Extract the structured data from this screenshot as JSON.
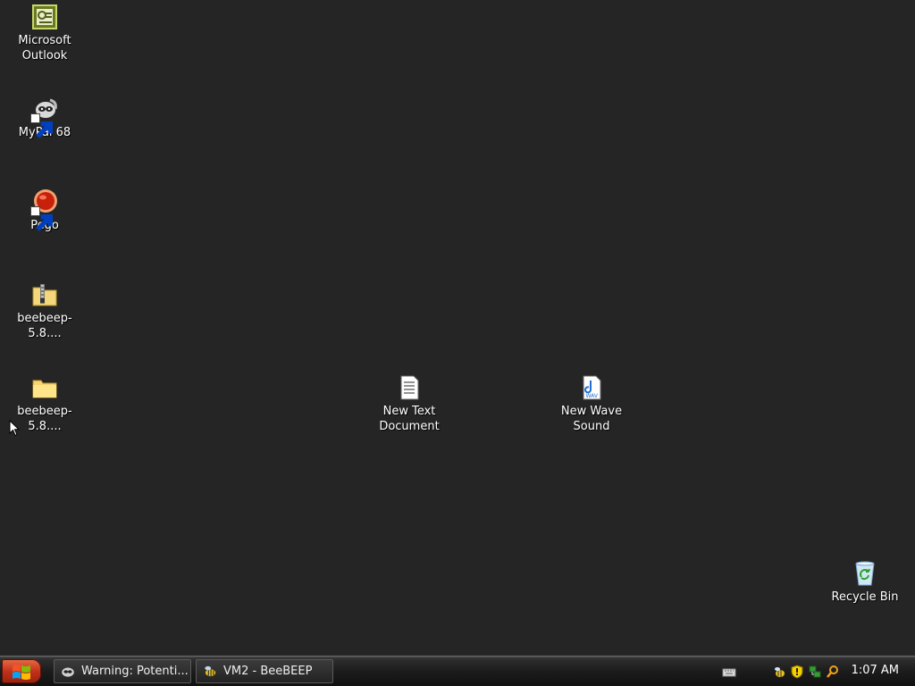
{
  "desktop": {
    "background_color": "#252525",
    "icons": {
      "outlook": {
        "label": "Microsoft\nOutlook",
        "icon": "outlook-icon"
      },
      "mypal": {
        "label": "MyPal 68",
        "icon": "mypal-raccoon-icon"
      },
      "pego": {
        "label": "Pego",
        "icon": "pego-red-ball-icon"
      },
      "beebeep_zip": {
        "label": "beebeep-5.8....",
        "icon": "zip-folder-icon"
      },
      "beebeep_folder": {
        "label": "beebeep-5.8....",
        "icon": "folder-icon"
      },
      "new_text": {
        "label": "New Text\nDocument",
        "icon": "text-document-icon"
      },
      "new_wave": {
        "label": "New Wave\nSound",
        "icon": "wav-file-icon"
      },
      "recycle_bin": {
        "label": "Recycle Bin",
        "icon": "recycle-bin-icon"
      }
    }
  },
  "taskbar": {
    "start_icon": "windows-logo-icon",
    "tasks": [
      {
        "label": "Warning: Potenti...",
        "icon": "mypal-raccoon-icon"
      },
      {
        "label": "VM2 - BeeBEEP",
        "icon": "bee-icon"
      }
    ],
    "tray_icons": [
      "keyboard-icon",
      "bee-icon",
      "security-shield-icon",
      "network-icon",
      "search-icon"
    ],
    "clock": "1:07 AM"
  }
}
